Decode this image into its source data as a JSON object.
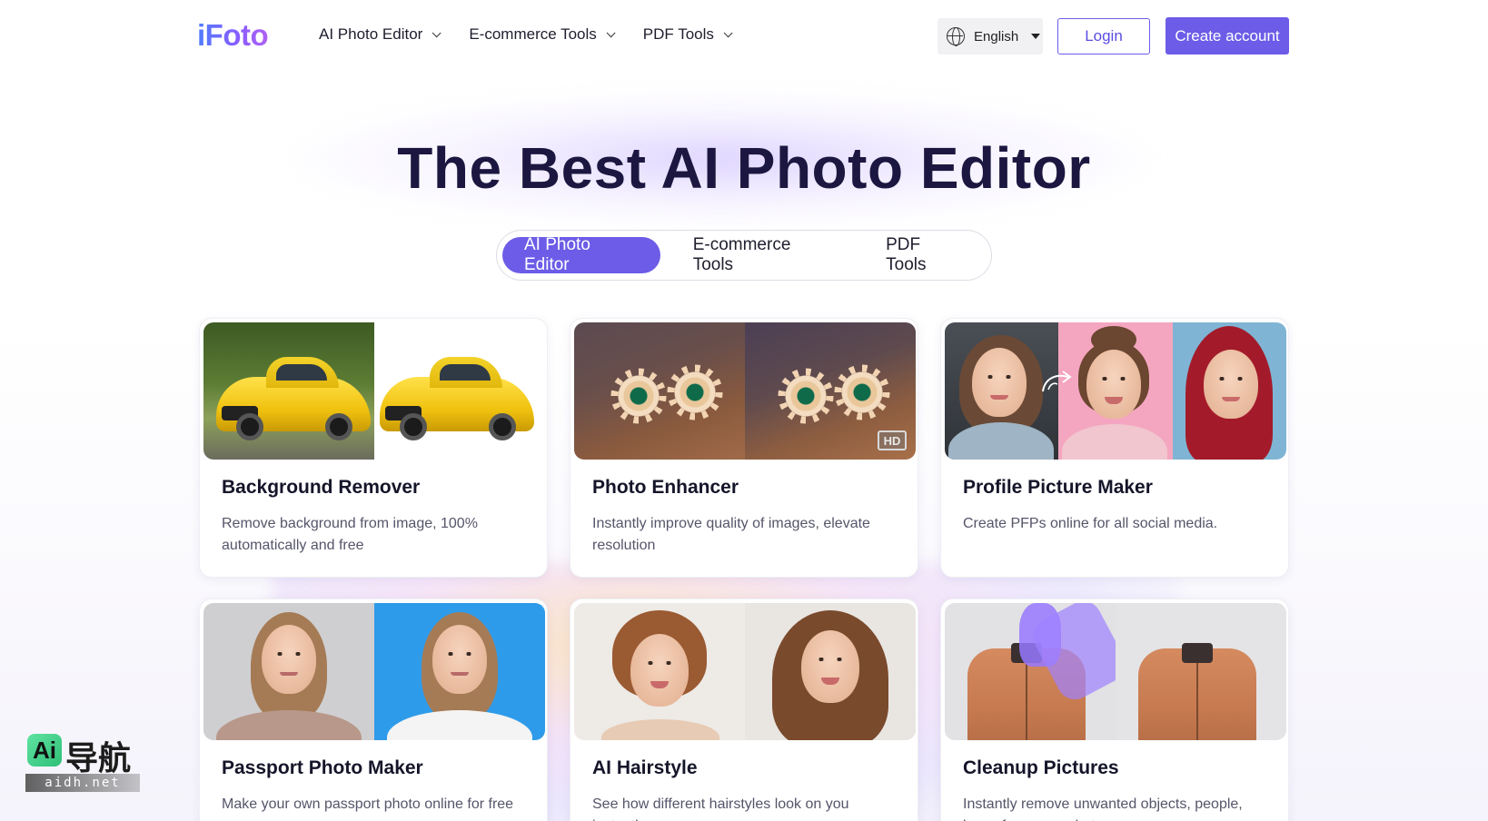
{
  "brand": {
    "logo": "iFoto",
    "logo_gradient": [
      "#4f7cff",
      "#b063f5"
    ]
  },
  "nav": {
    "items": [
      {
        "label": "AI Photo Editor"
      },
      {
        "label": "E-commerce Tools"
      },
      {
        "label": "PDF Tools"
      }
    ]
  },
  "header": {
    "language": "English",
    "login_label": "Login",
    "create_account_label": "Create account"
  },
  "colors": {
    "accent": "#6c5ce7",
    "title": "#1b1740",
    "text_muted": "#55556a"
  },
  "hero": {
    "title": "The Best AI Photo Editor",
    "tabs": [
      {
        "label": "AI Photo Editor",
        "active": true
      },
      {
        "label": "E-commerce Tools",
        "active": false
      },
      {
        "label": "PDF Tools",
        "active": false
      }
    ]
  },
  "cards": [
    {
      "title": "Background Remover",
      "desc": "Remove background from image, 100% automatically and free"
    },
    {
      "title": "Photo Enhancer",
      "desc": "Instantly improve quality of images, elevate resolution",
      "badge": "HD"
    },
    {
      "title": "Profile Picture Maker",
      "desc": "Create PFPs online for all social media."
    },
    {
      "title": "Passport Photo Maker",
      "desc": "Make your own passport photo online for free"
    },
    {
      "title": "AI Hairstyle",
      "desc": "See how different hairstyles look on you instantly"
    },
    {
      "title": "Cleanup Pictures",
      "desc": "Instantly remove unwanted objects, people, logos from your photos"
    }
  ],
  "watermark": {
    "badge": "Ai",
    "text": "导航",
    "sub": "aidh.net"
  }
}
